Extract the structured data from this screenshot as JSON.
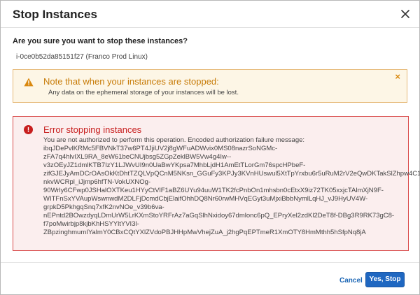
{
  "dialog": {
    "title": "Stop Instances",
    "question": "Are you sure you want to stop these instances?",
    "instance": "i-0ce0b52da85151f27 (Franco Prod Linux)"
  },
  "warning": {
    "title": "Note that when your instances are stopped:",
    "text": "Any data on the ephemeral storage of your instances will be lost.",
    "close_symbol": "×",
    "color": "#c77b07"
  },
  "error": {
    "title": "Error stopping instances",
    "color": "#c71e1e",
    "lines": [
      "You are not authorized to perform this operation. Encoded authorization failure message:",
      "ibqJDePvlKRMc5FBVNkT37w6PT4JjiUV2j8gWFuADWvix0MS08nazrSoNGMc-",
      "zFA7q4hlvIXL9RA_8eW61beCNUjbsg5ZGpZeklBW5Vw4g4Iw--",
      "v3zOEyJZ1dmlKTB7IzY1LJWvUI9n0UaBwYKpsa7MhbLjdH1AmEtTLorGm76spcHPbeF-",
      "zifGJEJyAmDCrOAsOkKtDhtTZQLVpQCnM5NKsn_GGuFy3KPJy3KVnHUswul5XtTpYrxbu6r5uRuM2rV2eQwDKTakSlZhpw4C1",
      "nkvWCRpl_iJjmp6hfTN-VokUXNOg-",
      "90Wrly6CFwp0JSHalOXTKeu1HYyCtVlF1aBZ6UYu94uuW1TK2fcPnbOn1mhsbn0cEtxX9iz72TK05xxjcTAlmXjN9F-",
      "WITFnSxYVAupWswnwdM2DLFjDcmdCbjElaifOhhDQ8Nr60rwMHVqEGyt3uMjxiBbbNymlLqHJ_vJ9HyUV4W-",
      "grpkD5PkhgqSnq7xfK2nvNOe_v39b6va-",
      "nEPntd2BOwzdyqLDmUrW5LrKXmStoYRFrAz7aGqSlhNxidoy67dmlonc6pQ_EPryXel2zdKl2DeT8f-DBg3R9RK73gC8-",
      "f7poMwirbjp8kjbKhHSYYltYVI3l-",
      "ZBpzinghmumIYalmY0CBxCQtYXlZVdoPBJHHpMwVhejZuA_j2hgPqEPTmeR1XmOTY8HmMthh5hSfpNq8jA"
    ]
  },
  "footer": {
    "cancel_label": "Cancel",
    "confirm_label": "Yes, Stop"
  },
  "colors": {
    "primary_button": "#1f67c1",
    "link": "#1b66b5"
  },
  "icons": {
    "close": "close-icon",
    "warning": "warning-triangle-icon",
    "error": "error-circle-icon"
  }
}
